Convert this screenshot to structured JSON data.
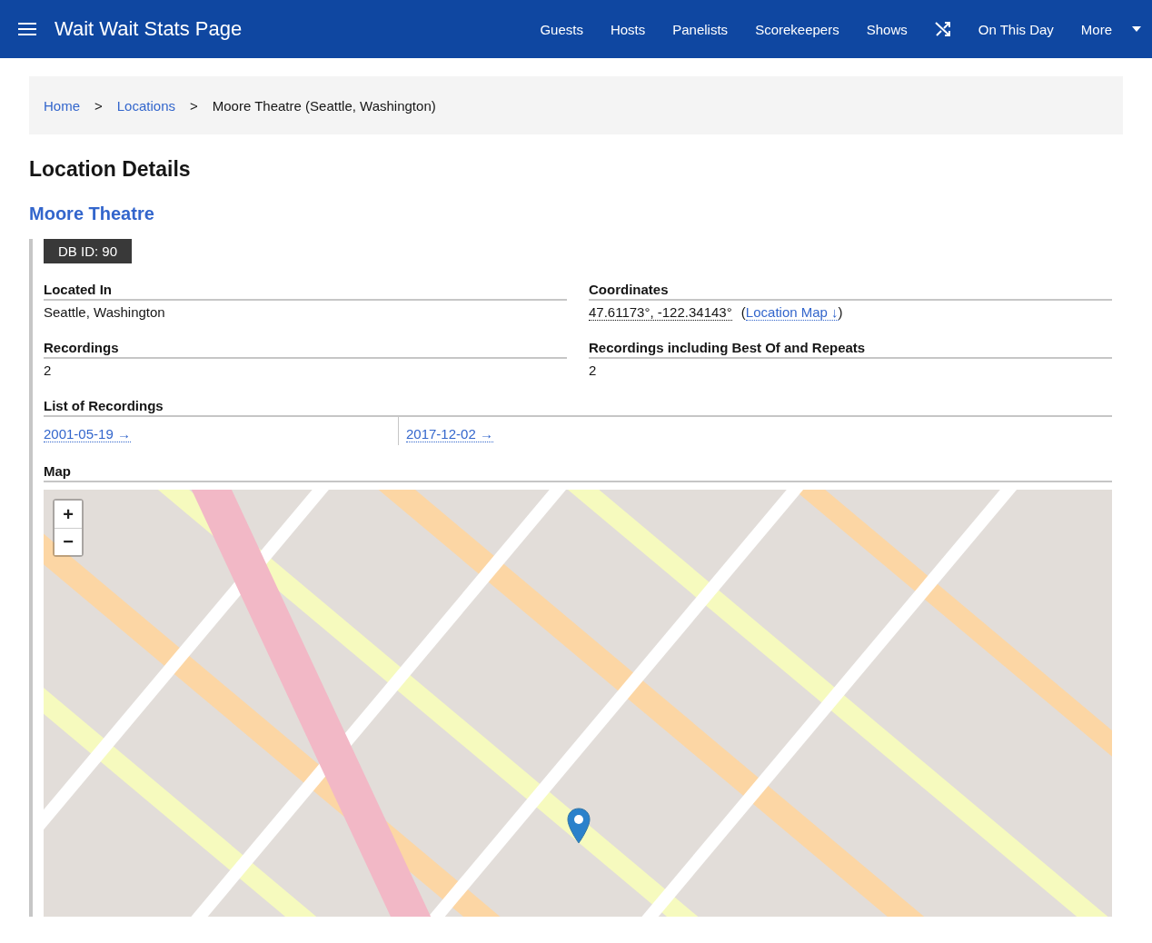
{
  "navbar": {
    "title": "Wait Wait Stats Page",
    "items": [
      {
        "kind": "link",
        "label": "Guests"
      },
      {
        "kind": "link",
        "label": "Hosts"
      },
      {
        "kind": "link",
        "label": "Panelists"
      },
      {
        "kind": "link",
        "label": "Scorekeepers"
      },
      {
        "kind": "link",
        "label": "Shows"
      },
      {
        "kind": "random"
      },
      {
        "kind": "link",
        "label": "On This Day"
      },
      {
        "kind": "dropdown",
        "label": "More"
      }
    ]
  },
  "breadcrumb": {
    "links": [
      "Home",
      "Locations"
    ],
    "separator": ">",
    "current": "Moore Theatre (Seattle, Washington)"
  },
  "heading": "Location Details",
  "location": {
    "name": "Moore Theatre",
    "db_id": "DB ID: 90",
    "fields": [
      {
        "kind": "text",
        "label": "Located In",
        "value": "Seattle, Washington"
      },
      {
        "kind": "coords",
        "label": "Coordinates",
        "value": "47.61173°, -122.34143°",
        "link_open": "(",
        "link": "Location Map ↓",
        "link_close": ")"
      },
      {
        "kind": "text",
        "label": "Recordings",
        "value": "2"
      },
      {
        "kind": "text",
        "label": "Recordings including Best Of and Repeats",
        "value": "2"
      }
    ],
    "recordings": {
      "label": "List of Recordings",
      "items": [
        "2001-05-19 →",
        "2017-12-02 →"
      ]
    },
    "map": {
      "label": "Map",
      "zoom_in": "+",
      "zoom_out": "−"
    }
  }
}
